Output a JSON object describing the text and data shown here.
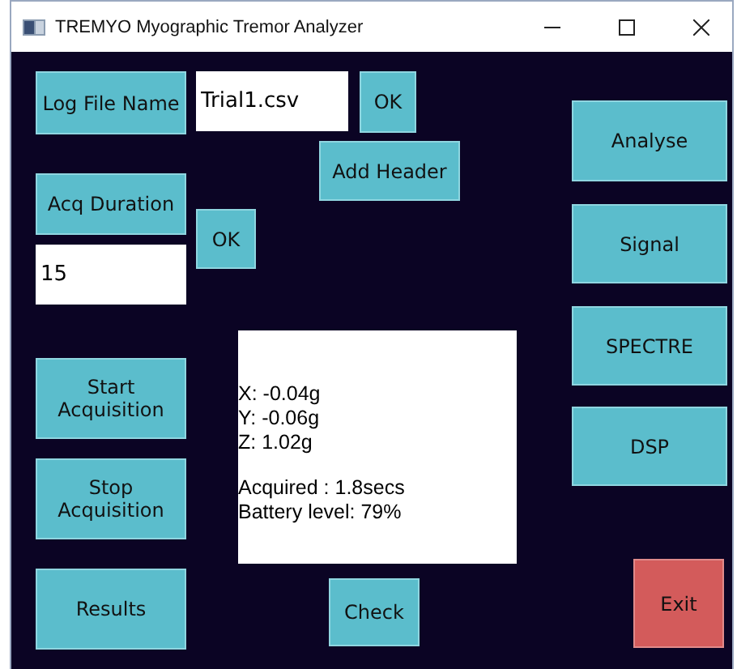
{
  "window": {
    "title": "TREMYO Myographic Tremor Analyzer"
  },
  "controls": [
    {
      "kind": "button",
      "label": "Log File Name"
    },
    {
      "kind": "field",
      "value": "Trial1.csv"
    },
    {
      "kind": "button",
      "label": "OK"
    },
    {
      "kind": "button",
      "label": "Add Header"
    },
    {
      "kind": "button",
      "label": "Acq Duration"
    },
    {
      "kind": "field",
      "value": "15"
    },
    {
      "kind": "button",
      "label": "OK"
    },
    {
      "kind": "button",
      "label": "Start Acquisition"
    },
    {
      "kind": "button",
      "label": "Stop Acquisition"
    },
    {
      "kind": "button",
      "label": "Results"
    },
    {
      "kind": "button",
      "label": "Check"
    },
    {
      "kind": "button",
      "label": "Analyse"
    },
    {
      "kind": "button",
      "label": "Signal"
    },
    {
      "kind": "button",
      "label": "SPECTRE"
    },
    {
      "kind": "button",
      "label": "DSP"
    },
    {
      "kind": "danger",
      "label": "Exit"
    }
  ],
  "readout": {
    "axes": [
      "X: -0.04g",
      "Y: -0.06g",
      "Z: 1.02g"
    ],
    "status": [
      "Acquired : 1.8secs",
      "Battery level: 79%"
    ]
  }
}
